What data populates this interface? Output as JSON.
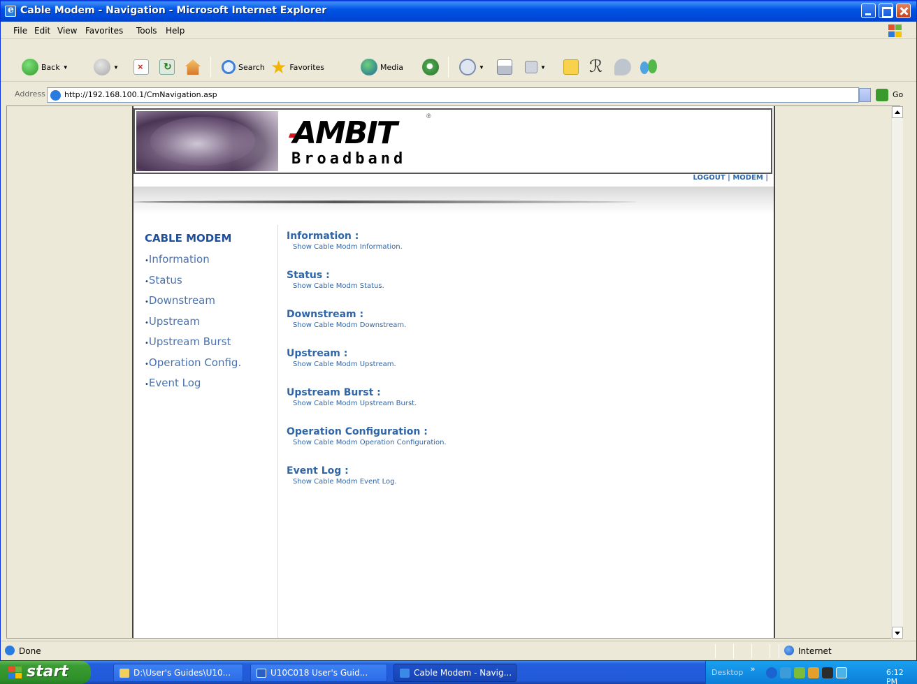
{
  "window": {
    "title": "Cable Modem - Navigation - Microsoft Internet Explorer"
  },
  "menu": [
    "File",
    "Edit",
    "View",
    "Favorites",
    "Tools",
    "Help"
  ],
  "toolbar": {
    "back_label": "Back",
    "search_label": "Search",
    "favorites_label": "Favorites",
    "media_label": "Media"
  },
  "address": {
    "label": "Address",
    "url": "http://192.168.100.1/CmNavigation.asp",
    "go_label": "Go"
  },
  "page": {
    "logo_text": "AMBIT",
    "logo_reg": "®",
    "logo_sub": "Broadband",
    "toplinks": {
      "logout": "LOGOUT",
      "modem": "MODEM",
      "sep": "|"
    },
    "sidebar": {
      "heading": "CABLE MODEM",
      "items": [
        "Information",
        "Status",
        "Downstream",
        "Upstream",
        "Upstream Burst",
        "Operation Config.",
        "Event Log"
      ]
    },
    "entries": [
      {
        "title": "Information :",
        "desc": "Show Cable Modm Information."
      },
      {
        "title": "Status :",
        "desc": "Show Cable Modm Status."
      },
      {
        "title": "Downstream :",
        "desc": "Show Cable Modm Downstream."
      },
      {
        "title": "Upstream :",
        "desc": "Show Cable Modm Upstream."
      },
      {
        "title": "Upstream Burst :",
        "desc": "Show Cable Modm Upstream Burst."
      },
      {
        "title": "Operation Configuration :",
        "desc": "Show Cable Modm Operation Configuration."
      },
      {
        "title": "Event Log :",
        "desc": "Show Cable Modm Event Log."
      }
    ]
  },
  "status": {
    "left": "Done",
    "zone": "Internet"
  },
  "taskbar": {
    "start_label": "start",
    "tasks": [
      {
        "label": "D:\\User's Guides\\U10..."
      },
      {
        "label": "U10C018 User's Guid..."
      },
      {
        "label": "Cable Modem - Navig..."
      }
    ],
    "desktop_label": "Desktop",
    "clock": "6:12 PM"
  },
  "colors": {
    "link_blue": "#2f66a8",
    "heading_blue": "#1f4e9a",
    "titlebar_blue": "#0055e5",
    "start_green": "#3a9c32"
  }
}
